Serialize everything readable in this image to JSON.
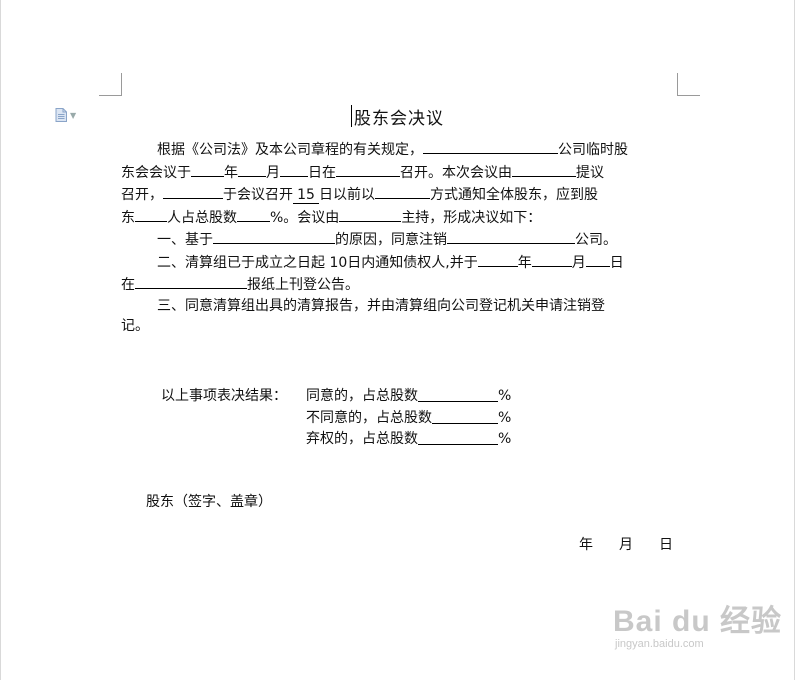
{
  "document": {
    "title": "股东会决议",
    "paragraph1": {
      "a": "根据《公司法》及本公司章程的有关规定，",
      "b": "公司临时股",
      "c": "东会会议于",
      "d": "年",
      "e": "月",
      "f": "日在",
      "g": "召开。本次会议由",
      "h": "提议",
      "i": "召开，",
      "j": "于会议召开",
      "k": "15",
      "l": "日以前以",
      "m": "方式通知全体股东，应到股",
      "n": "东",
      "o": "人占总股数",
      "p": "%。会议由",
      "q": "主持，形成决议如下："
    },
    "item1": {
      "a": "一、基于",
      "b": "的原因，同意注销",
      "c": "公司。"
    },
    "item2": {
      "a": "二、清算组已于成立之日起 10日内通知债权人,并于",
      "b": "年",
      "c": "月",
      "d": "日",
      "e": "在",
      "f": "报纸上刊登公告。"
    },
    "item3": {
      "line1": "三、同意清算组出具的清算报告，并由清算组向公司登记机关申请注销登",
      "line2": "记。"
    },
    "results": {
      "lead": "以上事项表决结果：",
      "agree": "同意的，占总股数",
      "disagree": "不同意的，占总股数",
      "abstain": "弃权的，占总股数",
      "percent": "%"
    },
    "signature": "股东（签字、盖章）",
    "date": {
      "year": "年",
      "month": "月",
      "day": "日"
    }
  },
  "watermark": {
    "brand": "Bai du 经验",
    "url": "jingyan.baidu.com"
  },
  "icons": {
    "doc_icon": "document-icon",
    "dropdown": "dropdown-arrow-icon"
  },
  "colors": {
    "text": "#111111",
    "watermark": "#c8c8c8",
    "icon": "#8aa4c8"
  }
}
